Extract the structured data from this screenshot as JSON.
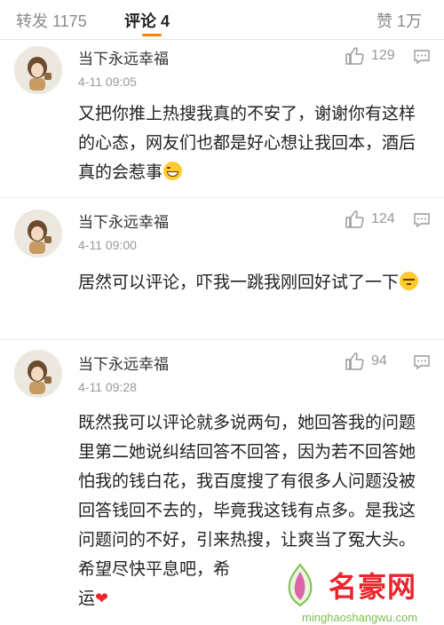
{
  "tabs": {
    "repost": "转发 1175",
    "comment": "评论 4",
    "like": "赞 1万"
  },
  "colors": {
    "accent": "#ff8200",
    "heart": "#e8262d"
  },
  "comments": [
    {
      "user": "当下永远幸福",
      "time": "4-11 09:05",
      "likes": "129",
      "text": "又把你推上热搜我真的不安了，谢谢你有这样的心态，网友们也都是好心想让我回本，酒后真的会惹事",
      "emoji": "laugh-cry-icon"
    },
    {
      "user": "当下永远幸福",
      "time": "4-11 09:00",
      "likes": "124",
      "text": "居然可以评论，吓我一跳我刚回好试了一下",
      "emoji": "shy-icon"
    },
    {
      "user": "当下永远幸福",
      "time": "4-11 09:28",
      "likes": "94",
      "text": "既然我可以评论就多说两句，她回答我的问题里第二她说纠结回答不回答，因为若不回答她怕我的钱白花，我百度搜了有很多人问题没被回答钱回不去的，毕竟我这钱有点多。是我这问题问的不好，引来热搜，让爽当了冤大头。希望尽快平息吧，希",
      "text_tail": "运",
      "emoji": "heart-icon"
    }
  ],
  "watermark": {
    "brand": "名豪网",
    "url": "minghaoshangwu.com"
  }
}
